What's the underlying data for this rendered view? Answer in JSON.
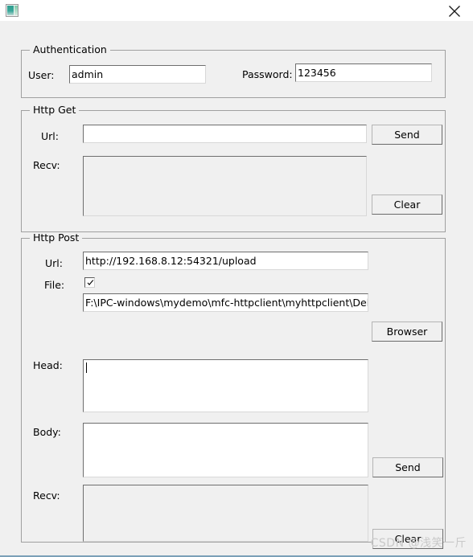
{
  "window": {
    "icon_name": "app-window-icon",
    "close_label": "✕"
  },
  "auth": {
    "title": "Authentication",
    "user_label": "User:",
    "user_value": "admin",
    "password_label": "Password:",
    "password_value": "123456"
  },
  "http_get": {
    "title": "Http Get",
    "url_label": "Url:",
    "url_value": "",
    "url_placeholder": "",
    "send_label": "Send",
    "recv_label": "Recv:",
    "recv_value": "",
    "clear_label": "Clear"
  },
  "http_post": {
    "title": "Http Post",
    "url_label": "Url:",
    "url_value": "http://192.168.8.12:54321/upload",
    "file_label": "File:",
    "file_checked": true,
    "file_path_value": "F:\\IPC-windows\\mydemo\\mfc-httpclient\\myhttpclient\\Debug\\t",
    "browser_label": "Browser",
    "head_label": "Head:",
    "head_value": "",
    "body_label": "Body:",
    "body_value": "",
    "send_label": "Send",
    "recv_label": "Recv:",
    "recv_value": "",
    "clear_label": "Clear"
  },
  "watermark": {
    "text": "CSDN @浅笑一斤"
  },
  "colors": {
    "window_bg": "#f0f0f0",
    "titlebar_bg": "#ffffff",
    "field_bg": "#ffffff",
    "disabled_field_bg": "#f0f0f0",
    "group_border": "#a0a0a0",
    "text": "#000000",
    "watermark": "#c9c9c9"
  }
}
